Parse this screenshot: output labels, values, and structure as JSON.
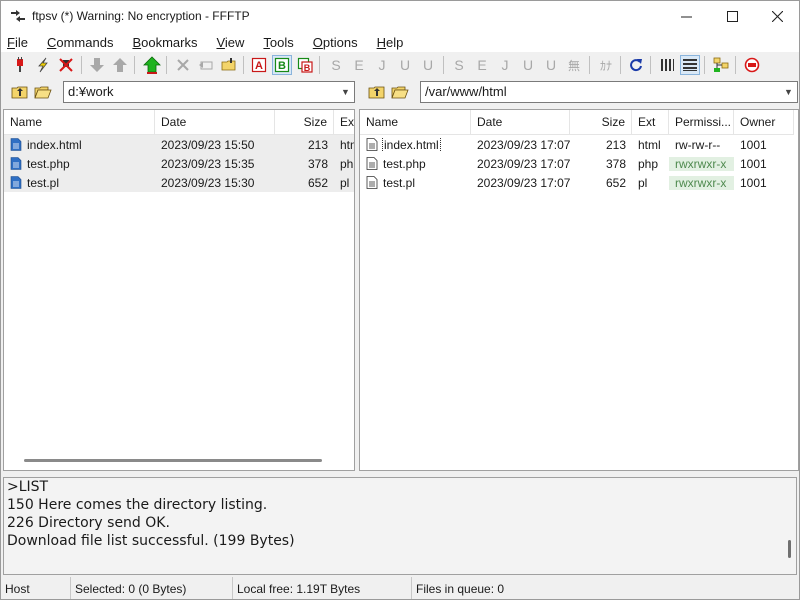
{
  "window": {
    "title": "ftpsv (*) Warning: No encryption - FFFTP"
  },
  "menu": [
    {
      "label": "File",
      "u": "F",
      "rest": "ile"
    },
    {
      "label": "Commands",
      "u": "C",
      "rest": "ommands"
    },
    {
      "label": "Bookmarks",
      "u": "B",
      "rest": "ookmarks"
    },
    {
      "label": "View",
      "u": "V",
      "rest": "iew"
    },
    {
      "label": "Tools",
      "u": "T",
      "rest": "ools"
    },
    {
      "label": "Options",
      "u": "O",
      "rest": "ptions"
    },
    {
      "label": "Help",
      "u": "H",
      "rest": "elp"
    }
  ],
  "toolbar": {
    "kanji_sjis": "S",
    "kanji_euc": "E",
    "kanji_jis": "J",
    "kanji_utf8": "U",
    "kanji_utf8bom": "U",
    "kanji_none": "無",
    "kana": "ｶﾅ",
    "ascii_label": "A",
    "binary_label": "B",
    "auto_label": "B"
  },
  "local": {
    "path": "d:¥work",
    "columns": {
      "name": "Name",
      "date": "Date",
      "size": "Size",
      "ext": "Ext"
    },
    "files": [
      {
        "name": "index.html",
        "date": "2023/09/23 15:50",
        "size": "213",
        "ext": "htm"
      },
      {
        "name": "test.php",
        "date": "2023/09/23 15:35",
        "size": "378",
        "ext": "php"
      },
      {
        "name": "test.pl",
        "date": "2023/09/23 15:30",
        "size": "652",
        "ext": "pl"
      }
    ]
  },
  "remote": {
    "path": "/var/www/html",
    "columns": {
      "name": "Name",
      "date": "Date",
      "size": "Size",
      "ext": "Ext",
      "perm": "Permissi...",
      "owner": "Owner"
    },
    "files": [
      {
        "name": "index.html",
        "date": "2023/09/23 17:07",
        "size": "213",
        "ext": "html",
        "perm": "rw-rw-r--",
        "owner": "1001"
      },
      {
        "name": "test.php",
        "date": "2023/09/23 17:07",
        "size": "378",
        "ext": "php",
        "perm": "rwxrwxr-x",
        "owner": "1001"
      },
      {
        "name": "test.pl",
        "date": "2023/09/23 17:07",
        "size": "652",
        "ext": "pl",
        "perm": "rwxrwxr-x",
        "owner": "1001"
      }
    ]
  },
  "log": [
    ">LIST",
    "150 Here comes the directory listing.",
    "226 Directory send OK.",
    "Download file list successful. (199 Bytes)"
  ],
  "status": {
    "host": "Host",
    "selected": "Selected: 0 (0 Bytes)",
    "local_free": "Local free: 1.19T Bytes",
    "queue": "Files in queue: 0"
  }
}
